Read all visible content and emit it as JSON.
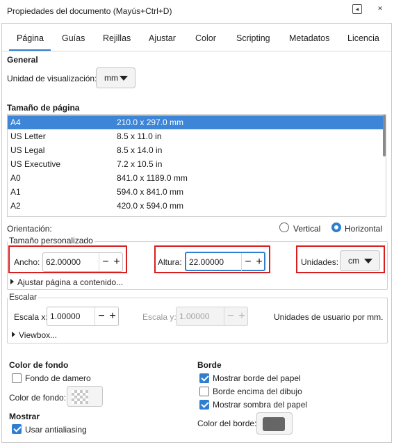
{
  "window": {
    "title": "Propiedades del documento (Mayús+Ctrl+D)",
    "minimize_glyph": "◂",
    "close_glyph": "✕"
  },
  "tabs": [
    {
      "label": "Página"
    },
    {
      "label": "Guías"
    },
    {
      "label": "Rejillas"
    },
    {
      "label": "Ajustar"
    },
    {
      "label": "Color"
    },
    {
      "label": "Scripting"
    },
    {
      "label": "Metadatos"
    },
    {
      "label": "Licencia"
    }
  ],
  "general": {
    "title": "General",
    "display_units_label": "Unidad de visualización:",
    "display_units_value": "mm"
  },
  "page_size": {
    "title": "Tamaño de página",
    "items": [
      {
        "name": "A4",
        "size": "210.0 x 297.0 mm"
      },
      {
        "name": "US Letter",
        "size": "8.5 x 11.0 in"
      },
      {
        "name": "US Legal",
        "size": "8.5 x 14.0 in"
      },
      {
        "name": "US Executive",
        "size": "7.2 x 10.5 in"
      },
      {
        "name": "A0",
        "size": "841.0 x 1189.0 mm"
      },
      {
        "name": "A1",
        "size": "594.0 x 841.0 mm"
      },
      {
        "name": "A2",
        "size": "420.0 x 594.0 mm"
      }
    ],
    "selected_index": 0
  },
  "orientation": {
    "label": "Orientación:",
    "vertical_label": "Vertical",
    "horizontal_label": "Horizontal",
    "selected": "Horizontal"
  },
  "custom_size": {
    "legend": "Tamaño personalizado",
    "width_label": "Ancho:",
    "width_value": "62.00000",
    "height_label": "Altura:",
    "height_value": "22.00000",
    "units_label": "Unidades:",
    "units_value": "cm",
    "resize_label": "Ajustar página a contenido..."
  },
  "scale": {
    "legend": "Escalar",
    "scale_x_label": "Escala x:",
    "scale_x_value": "1.00000",
    "scale_y_label": "Escala y:",
    "scale_y_value": "1.00000",
    "user_units_label": "Unidades de usuario por mm.",
    "viewbox_label": "Viewbox..."
  },
  "background": {
    "title": "Color de fondo",
    "checkerboard_label": "Fondo de damero",
    "checkerboard_checked": false,
    "bg_color_label": "Color de fondo:"
  },
  "display": {
    "title": "Mostrar",
    "antialias_label": "Usar antialiasing",
    "antialias_checked": true
  },
  "border": {
    "title": "Borde",
    "show_border_label": "Mostrar borde del papel",
    "show_border_checked": true,
    "border_on_top_label": "Borde encima del dibujo",
    "border_on_top_checked": false,
    "show_shadow_label": "Mostrar sombra del papel",
    "show_shadow_checked": true,
    "border_color_label": "Color del borde:",
    "border_color": "#666666"
  },
  "colors": {
    "accent": "#2f7fd0",
    "selection": "#3d85d6",
    "highlight_box": "#d91e1e"
  }
}
